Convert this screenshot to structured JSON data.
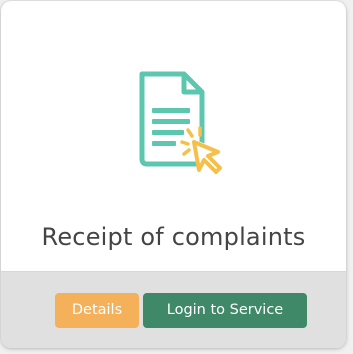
{
  "card": {
    "icon": "document-click-icon",
    "title": "Receipt of complaints",
    "colors": {
      "icon_teal": "#5cc7ae",
      "icon_cursor": "#f5c04a",
      "details_button": "#f5b05a",
      "login_button": "#3f8868",
      "footer_bg": "#e0e0e0",
      "title_text": "#444444"
    }
  },
  "actions": {
    "details_label": "Details",
    "login_label": "Login to Service"
  }
}
